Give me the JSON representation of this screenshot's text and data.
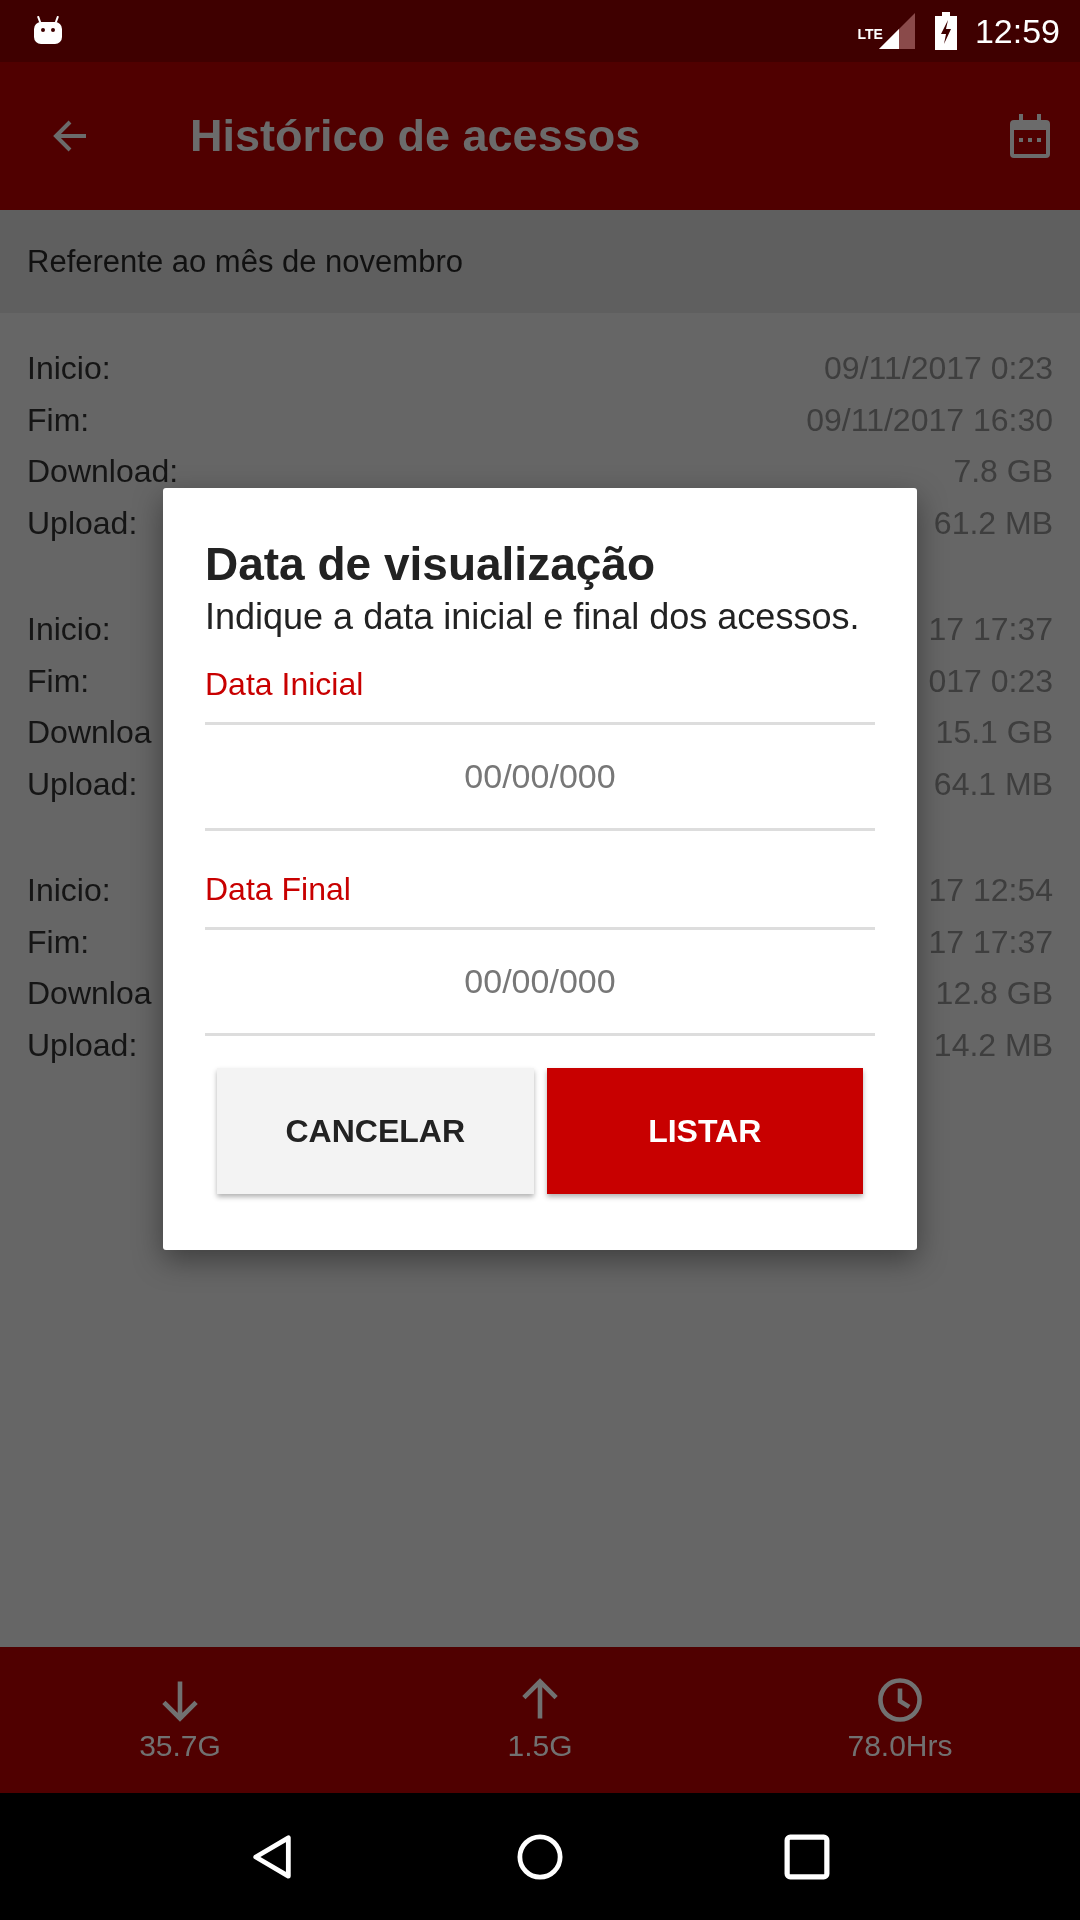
{
  "status_bar": {
    "network": "LTE",
    "time": "12:59"
  },
  "app_bar": {
    "title": "Histórico de acessos"
  },
  "subheader": "Referente ao mês de novembro",
  "records": [
    [
      {
        "label": "Inicio:",
        "value": "09/11/2017 0:23"
      },
      {
        "label": "Fim:",
        "value": "09/11/2017 16:30"
      },
      {
        "label": "Download:",
        "value": "7.8 GB"
      },
      {
        "label": "Upload:",
        "value": "61.2 MB"
      }
    ],
    [
      {
        "label": "Inicio:",
        "value": "17 17:37"
      },
      {
        "label": "Fim:",
        "value": "017 0:23"
      },
      {
        "label": "Downloa",
        "value": "15.1 GB"
      },
      {
        "label": "Upload:",
        "value": "64.1 MB"
      }
    ],
    [
      {
        "label": "Inicio:",
        "value": "17 12:54"
      },
      {
        "label": "Fim:",
        "value": "17 17:37"
      },
      {
        "label": "Downloa",
        "value": "12.8 GB"
      },
      {
        "label": "Upload:",
        "value": "14.2 MB"
      }
    ]
  ],
  "dialog": {
    "title": "Data de visualização",
    "message": "Indique a data inicial e final dos acessos.",
    "fields": [
      {
        "label": "Data Inicial",
        "placeholder": "00/00/000"
      },
      {
        "label": "Data Final",
        "placeholder": "00/00/000"
      }
    ],
    "buttons": [
      {
        "label": "CANCELAR",
        "kind": "secondary"
      },
      {
        "label": "LISTAR",
        "kind": "primary"
      }
    ]
  },
  "summary": [
    {
      "kind": "download",
      "value": "35.7G"
    },
    {
      "kind": "upload",
      "value": "1.5G"
    },
    {
      "kind": "time",
      "value": "78.0Hrs"
    }
  ]
}
